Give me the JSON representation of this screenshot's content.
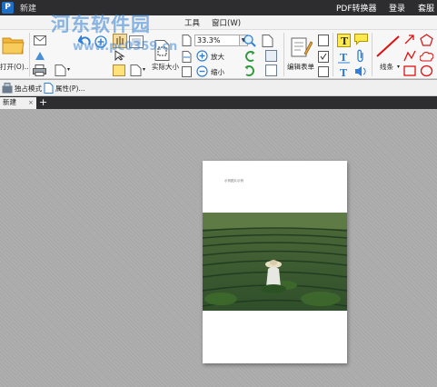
{
  "titlebar": {
    "logo": "P",
    "doc_title": "新建",
    "pdf_converter": "PDF转换器",
    "login": "登录",
    "more": "套服"
  },
  "watermark": {
    "text": "河东软件园",
    "url": "www.pc0359.cn"
  },
  "menubar": {
    "items": [
      "工具",
      "窗口(W)"
    ]
  },
  "ribbon": {
    "open_label": "打开(O)...",
    "actual_size_label": "实际大小",
    "zoom_value": "33.3%",
    "zoom_in_label": "放大",
    "zoom_out_label": "缩小",
    "edit_form_label": "编辑表单",
    "line_label": "线条"
  },
  "subbar": {
    "exclusive_mode": "独占模式",
    "properties": "属性(P)..."
  },
  "tabs": [
    {
      "label": "新建",
      "close": "×"
    }
  ],
  "tab_add": "+",
  "document": {
    "page_text": "示例图片示例"
  },
  "colors": {
    "titlebar_bg": "#2d2d30",
    "accent": "#1f6fc6",
    "watermark": "#2f7fd6"
  }
}
